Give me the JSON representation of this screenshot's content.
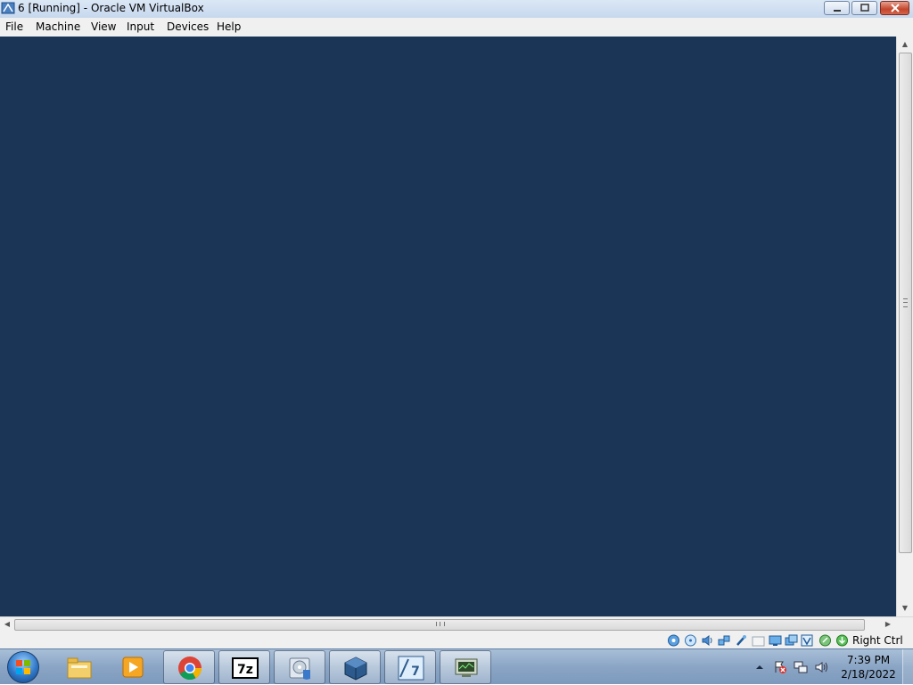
{
  "window": {
    "title": "6 [Running] - Oracle VM VirtualBox",
    "icon": "virtualbox-icon"
  },
  "menu": {
    "items": [
      "File",
      "Machine",
      "View",
      "Input",
      "Devices",
      "Help"
    ]
  },
  "vm_display": {
    "background_color": "#1b3556"
  },
  "statusbar": {
    "icons": [
      "hard-disk-icon",
      "optical-drive-icon",
      "audio-icon",
      "network-icon",
      "usb-icon",
      "shared-folders-icon",
      "display-icon",
      "video-capture-icon",
      "virtualization-icon",
      "mouse-integration-icon",
      "keyboard-capture-icon"
    ],
    "host_key": "Right Ctrl"
  },
  "taskbar": {
    "apps": [
      {
        "name": "windows-explorer-icon",
        "running": false
      },
      {
        "name": "media-player-icon",
        "running": false
      },
      {
        "name": "chrome-icon",
        "running": true
      },
      {
        "name": "7zip-icon",
        "label": "7z",
        "running": true
      },
      {
        "name": "disk-setup-icon",
        "running": true
      },
      {
        "name": "virtualbox-icon",
        "running": true
      },
      {
        "name": "windows7-64-vm-icon",
        "label": "7",
        "running": true
      },
      {
        "name": "network-monitor-icon",
        "running": true
      }
    ],
    "tray": {
      "icons": [
        "show-hidden-icons-icon",
        "action-center-icon",
        "network-tray-icon",
        "volume-icon"
      ],
      "time": "7:39 PM",
      "date": "2/18/2022"
    }
  }
}
